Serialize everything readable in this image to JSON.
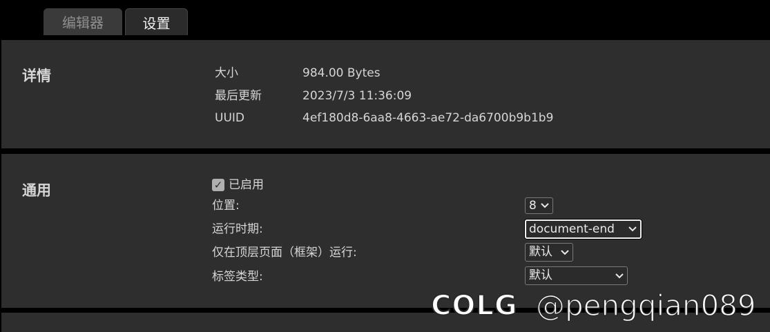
{
  "tabs": [
    {
      "label": "编辑器",
      "active": false
    },
    {
      "label": "设置",
      "active": true
    }
  ],
  "details": {
    "title": "详情",
    "rows": [
      {
        "key": "大小",
        "value": "984.00 Bytes"
      },
      {
        "key": "最后更新",
        "value": "2023/7/3 11:36:09"
      },
      {
        "key": "UUID",
        "value": "4ef180d8-6aa8-4663-ae72-da6700b9b1b9"
      }
    ]
  },
  "general": {
    "title": "通用",
    "enabled": {
      "label": "已启用",
      "checked": true
    },
    "options": [
      {
        "label": "位置:",
        "value": "8"
      },
      {
        "label": "运行时期:",
        "value": "document-end"
      },
      {
        "label": "仅在顶层页面（框架）运行:",
        "value": "默认"
      },
      {
        "label": "标签类型:",
        "value": "默认"
      }
    ]
  },
  "watermark": {
    "logo": "COLG",
    "handle": "@pengqian089"
  },
  "colors": {
    "background": "#000000",
    "panel": "#2e2e2e",
    "text": "#d6d6d6"
  }
}
